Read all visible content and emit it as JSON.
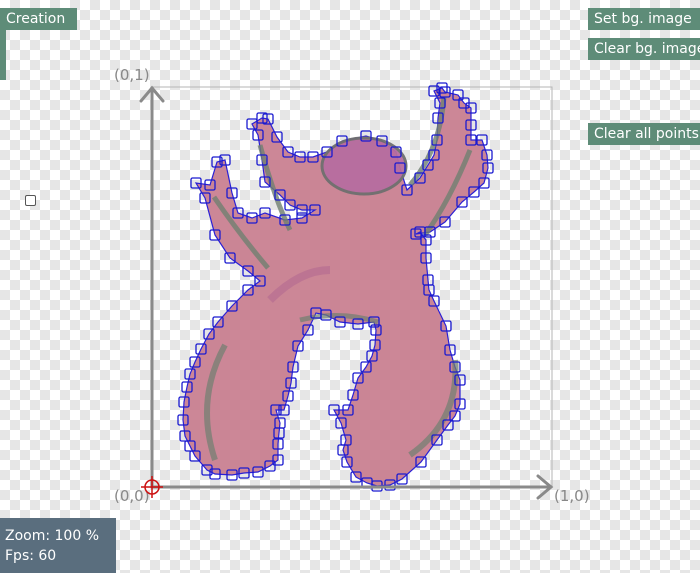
{
  "toolbar": {
    "creation_label": "Creation",
    "set_bg_label": "Set bg. image",
    "clear_bg_label": "Clear bg. image",
    "clear_points_label": "Clear all points"
  },
  "axes": {
    "origin_label": "(0,0)",
    "top_label": "(0,1)",
    "right_label": "(1,0)"
  },
  "status": {
    "zoom_text": "Zoom: 100 %",
    "fps_text": "Fps: 60"
  },
  "colors": {
    "button_bg": "#5e8c78",
    "status_bg": "#5a6e7e",
    "shape_fill": "#c77a8c",
    "shape_stroke": "#2a1fd6",
    "point_stroke": "#1a1ad0",
    "origin_marker": "#cc1111"
  },
  "icons": {
    "origin": "crosshair-icon",
    "side": "handle-icon"
  }
}
